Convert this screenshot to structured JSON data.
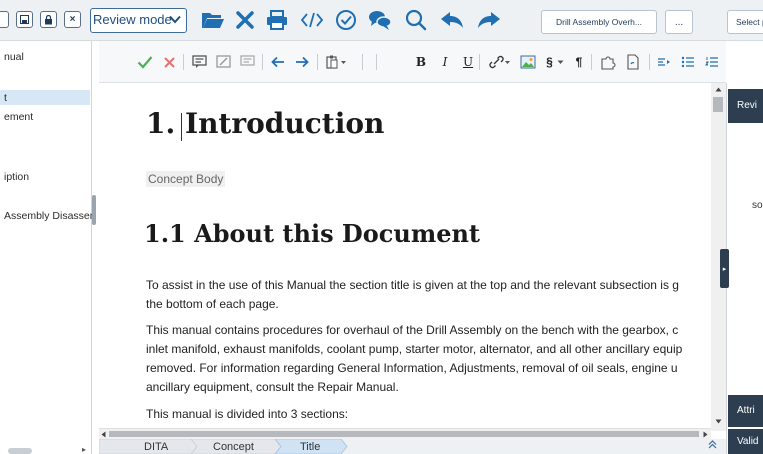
{
  "topbar": {
    "review_mode": "Review mode",
    "drill_tab": "Drill Assembly Overh...",
    "more_label": "...",
    "select_label": "Select p",
    "close_glyph": "×",
    "chev": "▾"
  },
  "left_panel": {
    "items": [
      "nual",
      "t",
      "ement",
      "iption",
      "Assembly Disassen"
    ]
  },
  "format_toolbar": {
    "bold": "B",
    "italic": "I",
    "underline": "U",
    "section": "§",
    "pilcrow": "¶"
  },
  "document": {
    "h1": "1.  Introduction",
    "concept_body": "Concept Body",
    "h2": "1.1  About this Document",
    "paragraphs": [
      "To assist in the use of this Manual the section title is given at the top and the relevant subsection is g",
      "the bottom of each page.",
      "This manual contains procedures for overhaul of the Drill Assembly on the bench with the gearbox, c",
      "inlet manifold, exhaust manifolds, coolant pump, starter motor, alternator, and all other ancillary equip",
      "removed. For information regarding General Information, Adjustments, removal of oil seals, engine u",
      "ancillary equipment, consult the Repair Manual.",
      "This manual is divided into 3 sections:"
    ]
  },
  "breadcrumb": [
    "DITA",
    "Concept",
    "Title"
  ],
  "right_panel": {
    "review_label": "Revi",
    "so_text": "so",
    "attr_label": "Attri",
    "valid_label": "Valid"
  },
  "colors": {
    "accent": "#1f6fb2",
    "check_green": "#4caf50",
    "x_red": "#e57373",
    "panel_dark": "#2c3e50"
  }
}
